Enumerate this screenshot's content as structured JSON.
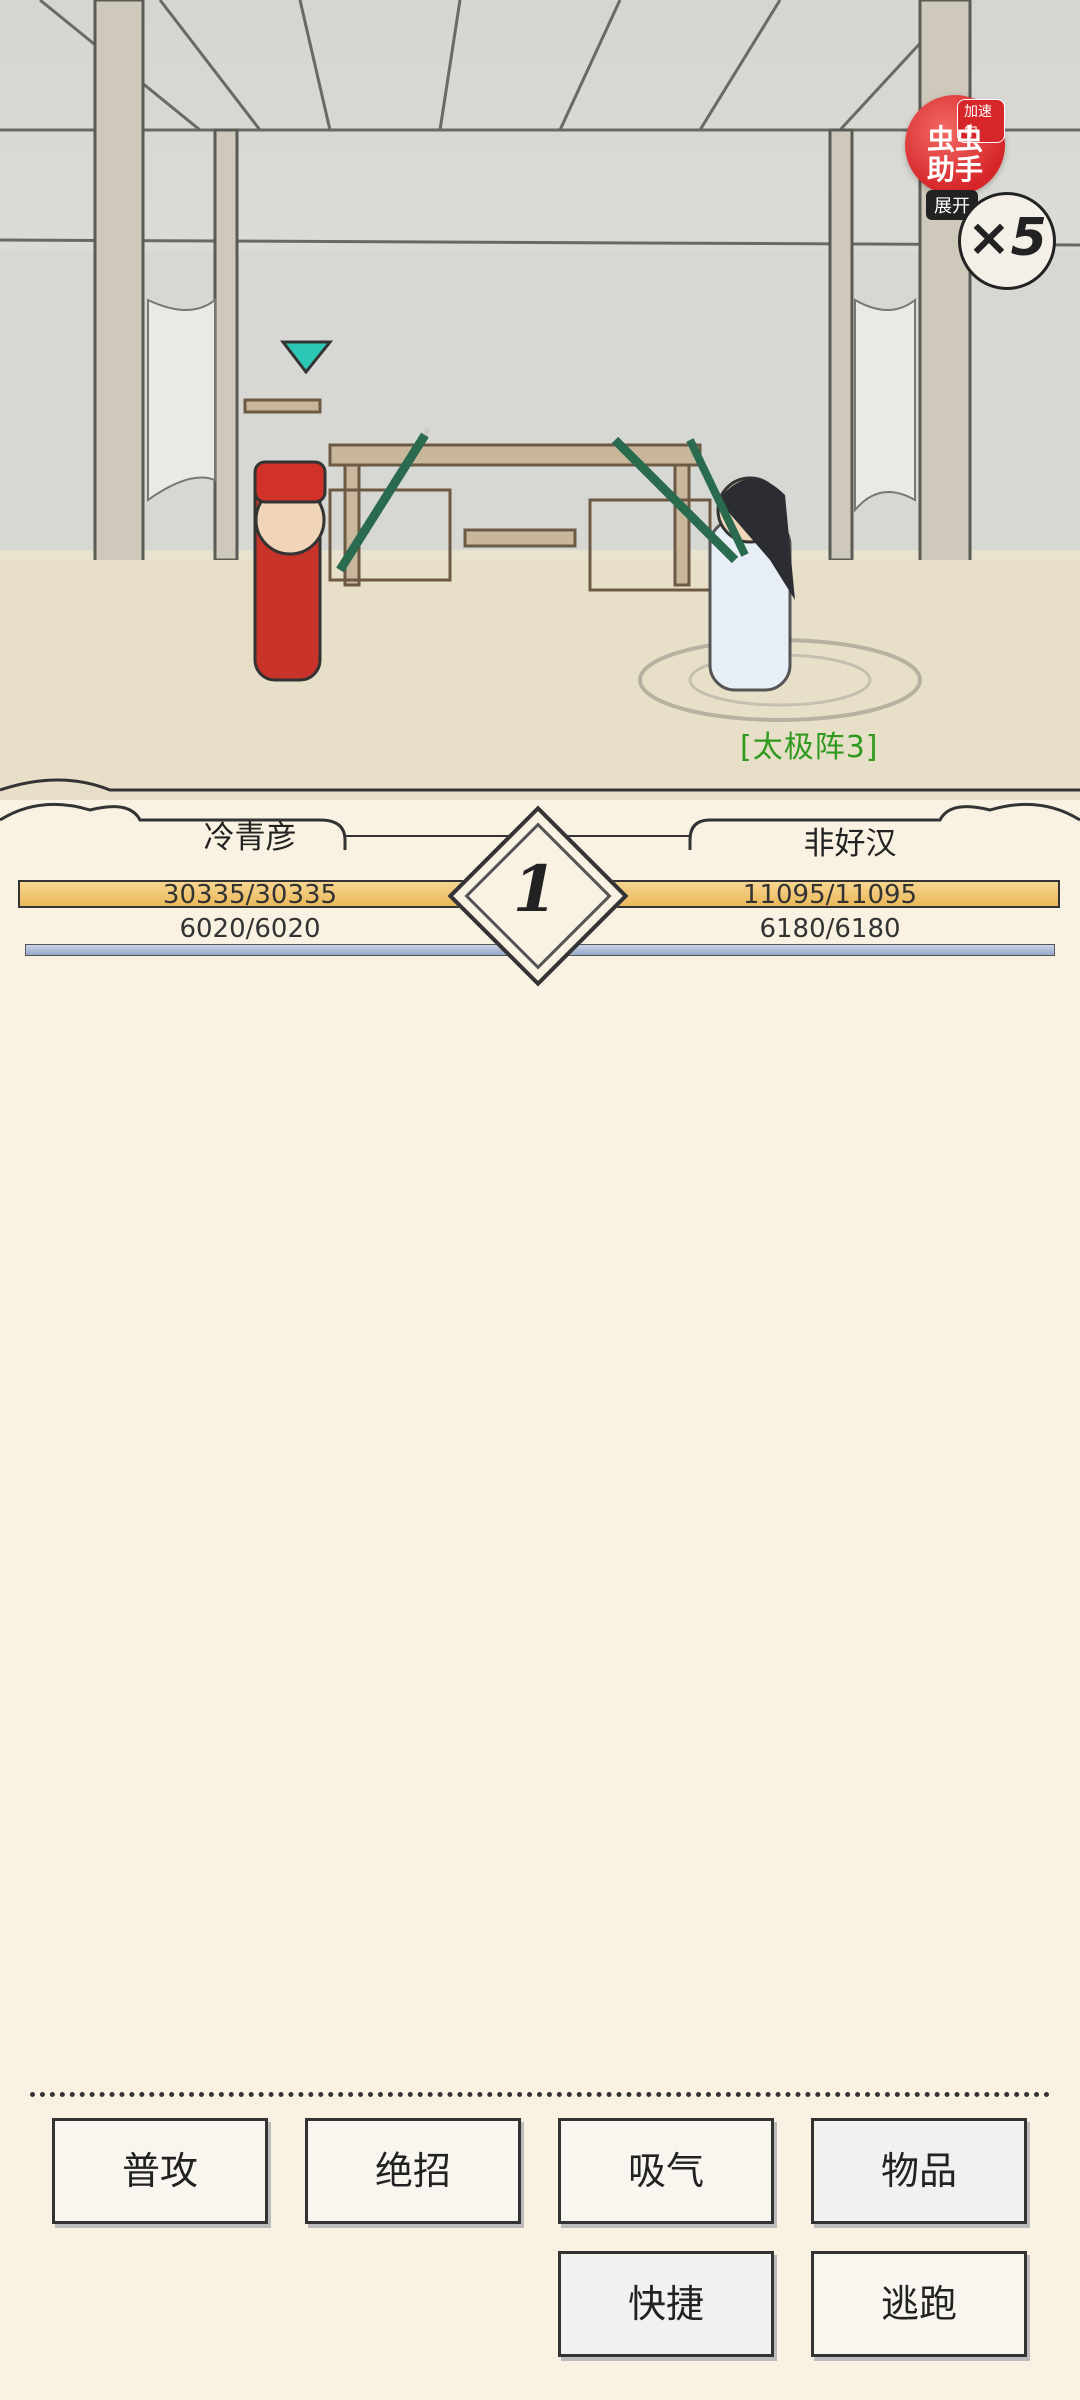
{
  "scene": {
    "status_tag": "[太极阵3]"
  },
  "helper": {
    "label_line1": "虫虫",
    "label_line2": "助手",
    "badge": "加速中",
    "expand": "展开",
    "speed": "×5"
  },
  "battle": {
    "turn": "1",
    "left": {
      "name": "冷青彦",
      "hp": "30335/30335",
      "mp": "6020/6020",
      "hp_fraction": 1.0,
      "mp_fraction": 1.0
    },
    "right": {
      "name": "非好汉",
      "hp": "11095/11095",
      "mp": "6180/6180",
      "hp_fraction": 1.0,
      "mp_fraction": 1.0
    }
  },
  "actions": {
    "attack": "普攻",
    "ultimate": "绝招",
    "breathe": "吸气",
    "items": "物品",
    "shortcut": "快捷",
    "flee": "逃跑"
  },
  "colors": {
    "background": "#f9f2e2",
    "hp_bar": "#eab85a",
    "mp_bar": "#97a7c8",
    "status_text": "#2f9a1f",
    "helper_red": "#d6262a"
  }
}
